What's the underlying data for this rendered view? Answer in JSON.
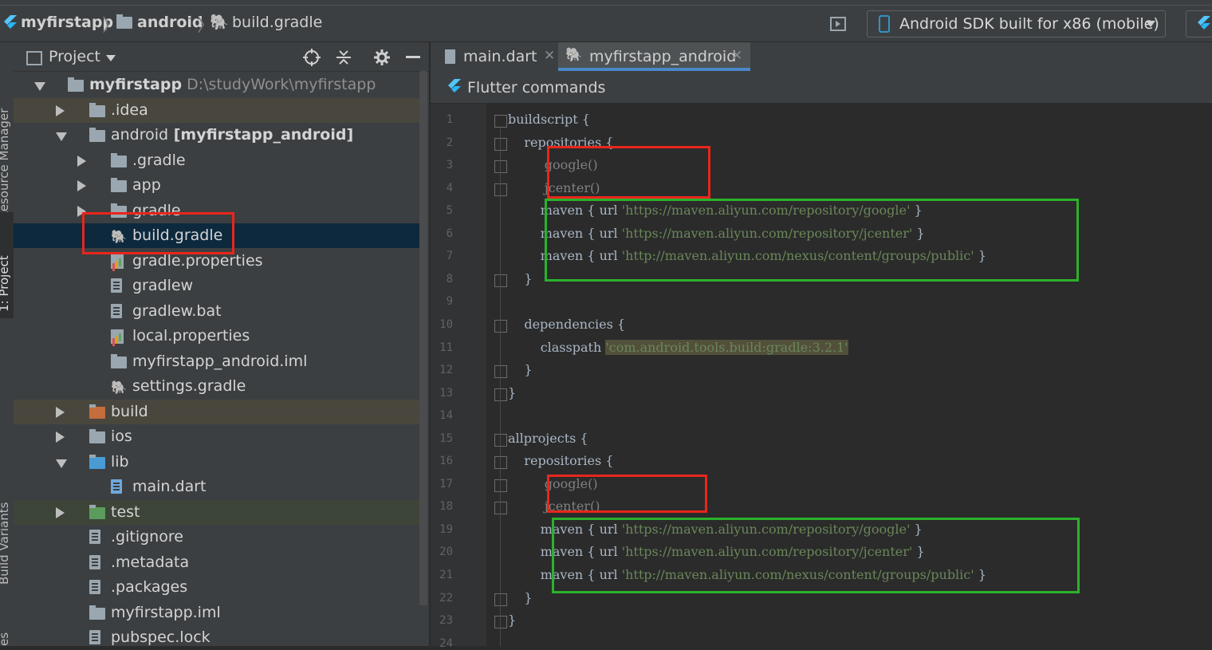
{
  "window": {
    "top_strip_text": "",
    "breadcrumb": [
      {
        "label": "myfirstapp",
        "icon": "flutter-icon"
      },
      {
        "label": "android",
        "icon": "folder-icon"
      },
      {
        "label": "build.gradle",
        "icon": "gradle-icon"
      }
    ],
    "device_selector": "Android SDK built for x86 (mobile)"
  },
  "left_strip": {
    "resource_manager": "Resource Manager",
    "project": "1: Project",
    "build_variants": "Build Variants",
    "bottom": "es"
  },
  "project_panel": {
    "title": "Project",
    "tree": [
      {
        "label": "myfirstapp",
        "path": "D:\\studyWork\\myfirstapp",
        "depth": 0,
        "expanded": true,
        "icon": "module"
      },
      {
        "label": ".idea",
        "depth": 1,
        "expanded": false,
        "icon": "folder-settings"
      },
      {
        "label": "android",
        "suffix": "[myfirstapp_android]",
        "depth": 1,
        "expanded": true,
        "icon": "module"
      },
      {
        "label": ".gradle",
        "depth": 2,
        "expanded": false,
        "icon": "folder"
      },
      {
        "label": "app",
        "depth": 2,
        "expanded": false,
        "icon": "folder"
      },
      {
        "label": "gradle",
        "depth": 2,
        "expanded": false,
        "icon": "folder"
      },
      {
        "label": "build.gradle",
        "depth": 2,
        "icon": "gradle",
        "selected": true
      },
      {
        "label": "gradle.properties",
        "depth": 2,
        "icon": "properties"
      },
      {
        "label": "gradlew",
        "depth": 2,
        "icon": "file"
      },
      {
        "label": "gradlew.bat",
        "depth": 2,
        "icon": "file"
      },
      {
        "label": "local.properties",
        "depth": 2,
        "icon": "properties"
      },
      {
        "label": "myfirstapp_android.iml",
        "depth": 2,
        "icon": "module"
      },
      {
        "label": "settings.gradle",
        "depth": 2,
        "icon": "gradle"
      },
      {
        "label": "build",
        "depth": 1,
        "expanded": false,
        "icon": "folder-excluded"
      },
      {
        "label": "ios",
        "depth": 1,
        "expanded": false,
        "icon": "module"
      },
      {
        "label": "lib",
        "depth": 1,
        "expanded": true,
        "icon": "folder-source"
      },
      {
        "label": "main.dart",
        "depth": 2,
        "icon": "dart"
      },
      {
        "label": "test",
        "depth": 1,
        "expanded": false,
        "icon": "folder-test"
      },
      {
        "label": ".gitignore",
        "depth": 1,
        "icon": "file"
      },
      {
        "label": ".metadata",
        "depth": 1,
        "icon": "file"
      },
      {
        "label": ".packages",
        "depth": 1,
        "icon": "file"
      },
      {
        "label": "myfirstapp.iml",
        "depth": 1,
        "icon": "module"
      },
      {
        "label": "pubspec.lock",
        "depth": 1,
        "icon": "file"
      }
    ]
  },
  "editor": {
    "tabs": [
      {
        "label": "main.dart",
        "active": false
      },
      {
        "label": "myfirstapp_android",
        "active": true
      }
    ],
    "flutter_bar": "Flutter commands",
    "lines": [
      {
        "n": "1",
        "text": "buildscript {"
      },
      {
        "n": "2",
        "text": "    repositories {"
      },
      {
        "n": "3",
        "text": "//          google()"
      },
      {
        "n": "4",
        "text": "//          jcenter()"
      },
      {
        "n": "5",
        "pre": "        maven { url ",
        "str": "'https://maven.aliyun.com/repository/google'",
        "post": " }"
      },
      {
        "n": "6",
        "pre": "        maven { url ",
        "str": "'https://maven.aliyun.com/repository/jcenter'",
        "post": " }"
      },
      {
        "n": "7",
        "pre": "        maven { url ",
        "str": "'http://maven.aliyun.com/nexus/content/groups/public'",
        "post": " }"
      },
      {
        "n": "8",
        "text": "    }"
      },
      {
        "n": "9",
        "text": ""
      },
      {
        "n": "10",
        "text": "    dependencies {"
      },
      {
        "n": "11",
        "pre": "        classpath ",
        "str": "'com.android.tools.build:gradle:3.2.1'",
        "post": ""
      },
      {
        "n": "12",
        "text": "    }"
      },
      {
        "n": "13",
        "text": "}"
      },
      {
        "n": "14",
        "text": ""
      },
      {
        "n": "15",
        "text": "allprojects {"
      },
      {
        "n": "16",
        "text": "    repositories {"
      },
      {
        "n": "17",
        "text": "//          google()"
      },
      {
        "n": "18",
        "text": "//          jcenter()"
      },
      {
        "n": "19",
        "pre": "        maven { url ",
        "str": "'https://maven.aliyun.com/repository/google'",
        "post": " }"
      },
      {
        "n": "20",
        "pre": "        maven { url ",
        "str": "'https://maven.aliyun.com/repository/jcenter'",
        "post": " }"
      },
      {
        "n": "21",
        "pre": "        maven { url ",
        "str": "'http://maven.aliyun.com/nexus/content/groups/public'",
        "post": " }"
      },
      {
        "n": "22",
        "text": "    }"
      },
      {
        "n": "23",
        "text": "}"
      },
      {
        "n": "24",
        "text": ""
      }
    ]
  },
  "colors": {
    "annotation_red": "#e8261c",
    "annotation_green": "#2bb22b",
    "selection": "#0d293e"
  }
}
